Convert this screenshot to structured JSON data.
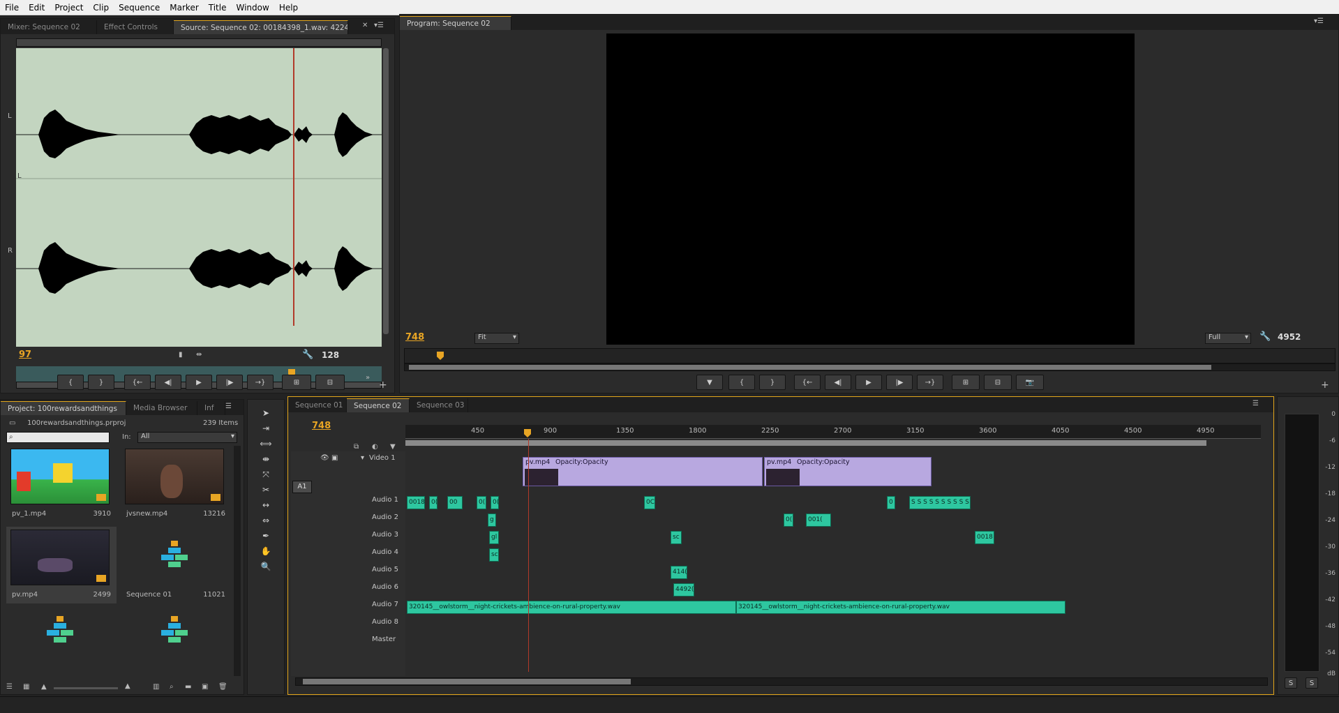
{
  "menu": [
    "File",
    "Edit",
    "Project",
    "Clip",
    "Sequence",
    "Marker",
    "Title",
    "Window",
    "Help"
  ],
  "source_panel": {
    "tabs": [
      "Mixer: Sequence 02",
      "Effect Controls",
      "Source: Sequence 02: 00184398_1.wav: 4224"
    ],
    "channel_left": "L",
    "channel_right": "R",
    "timecode_in": "97",
    "duration": "128"
  },
  "program_panel": {
    "tab": "Program: Sequence 02",
    "timecode": "748",
    "fit": "Fit",
    "quality": "Full",
    "duration": "4952"
  },
  "project_panel": {
    "tabs": [
      "Project: 100rewardsandthings",
      "Media Browser",
      "Inf"
    ],
    "project_file": "100rewardsandthings.prproj",
    "item_count": "239 Items",
    "in_label": "In:",
    "in_value": "All",
    "items": [
      {
        "name": "pv_1.mp4",
        "count": "3910"
      },
      {
        "name": "jvsnew.mp4",
        "count": "13216"
      },
      {
        "name": "pv.mp4",
        "count": "2499"
      },
      {
        "name": "Sequence 01",
        "count": "11021"
      },
      {
        "name": "",
        "count": ""
      },
      {
        "name": "",
        "count": ""
      }
    ]
  },
  "timeline": {
    "tabs": [
      "Sequence 01",
      "Sequence 02",
      "Sequence 03"
    ],
    "timecode": "748",
    "ruler_ticks": [
      "450",
      "900",
      "1350",
      "1800",
      "2250",
      "2700",
      "3150",
      "3600",
      "4050",
      "4500",
      "4950"
    ],
    "video_track": "Video 1",
    "video_clips": [
      {
        "name": "pv.mp4",
        "fx": "Opacity:Opacity"
      },
      {
        "name": "pv.mp4",
        "fx": "Opacity:Opacity"
      }
    ],
    "a1": "A1",
    "audio_tracks": [
      "Audio 1",
      "Audio 2",
      "Audio 3",
      "Audio 4",
      "Audio 5",
      "Audio 6",
      "Audio 7",
      "Audio 8"
    ],
    "master": "Master",
    "long_clip_label": "320145__owlstorm__night-crickets-ambience-on-rural-property.wav",
    "clip_labels": {
      "a1_first": "0018",
      "a1_b": "0(",
      "a1_c": "00",
      "a1_d": "0(",
      "a1_e": "0(",
      "a1_f": "0C",
      "a1_g": "0",
      "a1_h": "S S S S S S S S S S",
      "a2_a": "g",
      "a2_b": "0(",
      "a2_c": "001(",
      "a3_a": "0018",
      "a3_b": "sc",
      "a3_c": "gl",
      "a4_a": "sc",
      "a5_a": "414(",
      "a6_a": "4492("
    }
  },
  "meters": {
    "labels": [
      "0",
      "-6",
      "-12",
      "-18",
      "-24",
      "-30",
      "-36",
      "-42",
      "-48",
      "-54",
      "dB"
    ],
    "solo": "S"
  }
}
